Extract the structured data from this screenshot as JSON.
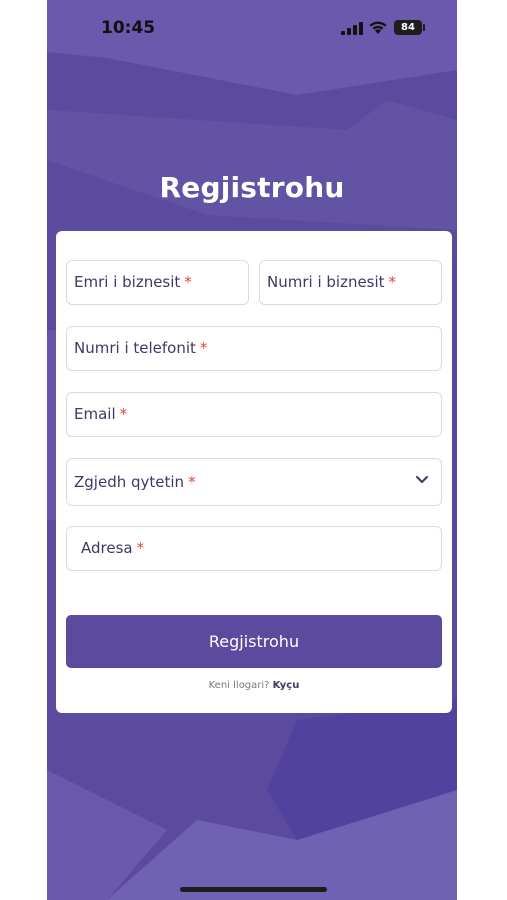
{
  "status_bar": {
    "time": "10:45",
    "battery": "84"
  },
  "page": {
    "title": "Regjistrohu"
  },
  "form": {
    "business_name_label": "Emri i biznesit",
    "business_number_label": "Numri i biznesit",
    "phone_label": "Numri i telefonit",
    "email_label": "Email",
    "city_label": "Zgjedh qytetin",
    "address_label": "Adresa",
    "required_marker": "*",
    "submit_label": "Regjistrohu",
    "login_prompt": "Keni llogari?",
    "login_link": "Kyçu"
  },
  "colors": {
    "primary": "#5c4a9e",
    "required": "#e0463a",
    "label_text": "#3f3866"
  },
  "icons": {
    "signal": "signal-icon",
    "wifi": "wifi-icon",
    "battery": "battery-icon",
    "dropdown": "chevron-down-icon"
  }
}
